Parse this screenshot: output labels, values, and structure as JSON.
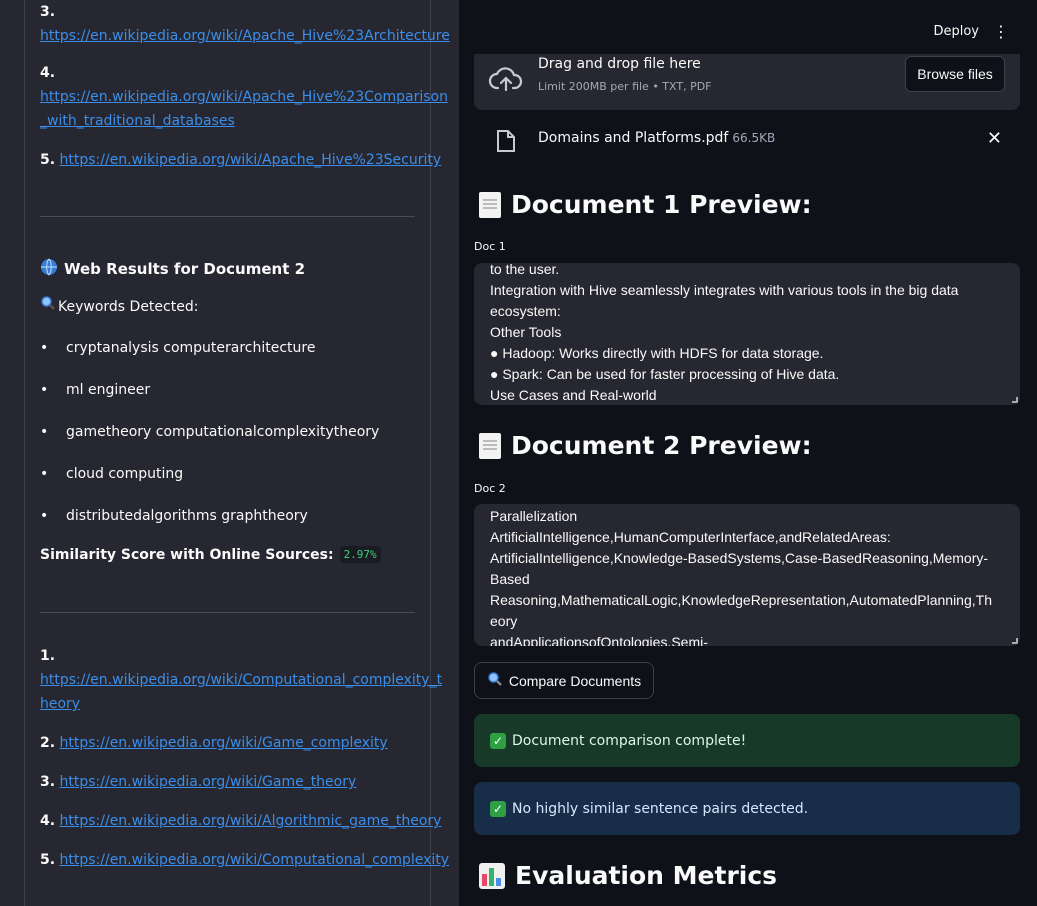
{
  "sidebar": {
    "top_links": [
      {
        "num": "3.",
        "url": "https://en.wikipedia.org/wiki/Apache_Hive%23Architecture"
      },
      {
        "num": "4.",
        "url_line1": "https://en.wikipedia.org/wiki/Apache_Hive%23Comparison",
        "url_line2": "_with_traditional_databases"
      },
      {
        "num": "5.",
        "url": "https://en.wikipedia.org/wiki/Apache_Hive%23Security"
      }
    ],
    "web_results_title": "Web Results for Document 2",
    "keywords_label": "Keywords Detected:",
    "keywords": [
      "cryptanalysis computerarchitecture",
      "ml engineer",
      "gametheory computationalcomplexitytheory",
      "cloud computing",
      "distributedalgorithms graphtheory"
    ],
    "similarity_label": "Similarity Score with Online Sources:",
    "similarity_value": "2.97%",
    "bottom_links": [
      {
        "num": "1.",
        "url_line1": "https://en.wikipedia.org/wiki/Computational_complexity_t",
        "url_line2": "heory"
      },
      {
        "num": "2.",
        "url": "https://en.wikipedia.org/wiki/Game_complexity"
      },
      {
        "num": "3.",
        "url": "https://en.wikipedia.org/wiki/Game_theory"
      },
      {
        "num": "4.",
        "url": "https://en.wikipedia.org/wiki/Algorithmic_game_theory"
      },
      {
        "num": "5.",
        "url": "https://en.wikipedia.org/wiki/Computational_complexity"
      }
    ]
  },
  "header": {
    "deploy_label": "Deploy",
    "menu_icon": "kebab-menu-icon"
  },
  "uploader": {
    "title": "Drag and drop file here",
    "subtitle": "Limit 200MB per file • TXT, PDF",
    "browse_label": "Browse files",
    "file_name": "Domains and Platforms.pdf",
    "file_size": "66.5KB",
    "close_symbol": "✕"
  },
  "doc1": {
    "heading": "Document 1 Preview:",
    "label": "Doc 1",
    "lines": [
      "to the user.",
      "Integration with Hive seamlessly integrates with various tools in the big data",
      "ecosystem:",
      "Other Tools",
      "● Hadoop: Works directly with HDFS for data storage.",
      "● Spark: Can be used for faster processing of Hive data.",
      "Use Cases and Real-world"
    ]
  },
  "doc2": {
    "heading": "Document 2 Preview:",
    "label": "Doc 2",
    "lines": [
      "Parallelization",
      "ArtificialIntelligence,HumanComputerInterface,andRelatedAreas:",
      "ArtificialIntelligence,Knowledge-BasedSystems,Case-BasedReasoning,Memory-",
      "Based",
      "Reasoning,MathematicalLogic,KnowledgeRepresentation,AutomatedPlanning,Th",
      "eory",
      "andApplicationsofOntologies,Semi-"
    ]
  },
  "compare_button": "Compare Documents",
  "alerts": {
    "success": "Document comparison complete!",
    "info": "No highly similar sentence pairs detected."
  },
  "metrics_heading": "Evaluation Metrics",
  "colors": {
    "link": "#3b8eea",
    "sidebar_bg": "#262730",
    "main_bg": "#0e1117",
    "success_bg": "#173928",
    "info_bg": "#172d48",
    "code_green": "#3ad07a"
  }
}
